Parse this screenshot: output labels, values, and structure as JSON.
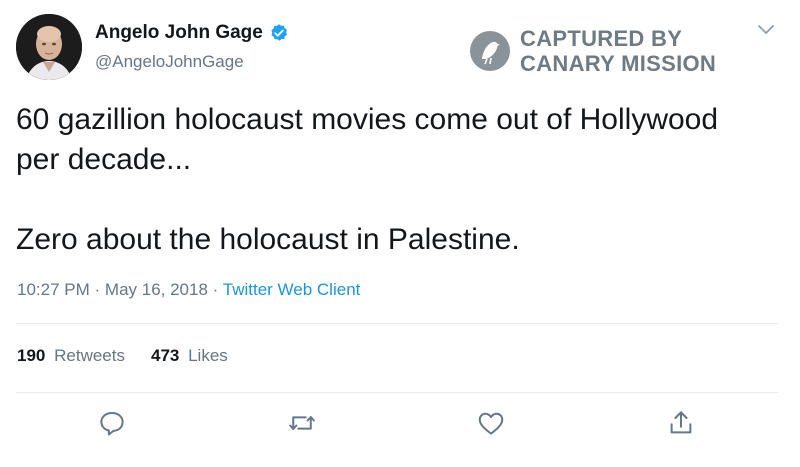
{
  "user": {
    "display_name": "Angelo John Gage",
    "handle": "@AngeloJohnGage",
    "verified": true
  },
  "watermark": {
    "line1": "CAPTURED BY",
    "line2": "CANARY MISSION"
  },
  "tweet": {
    "lines": [
      "60 gazillion holocaust movies come out of Hollywood",
      "per decade...",
      "Zero about the holocaust in Palestine."
    ]
  },
  "meta": {
    "time": "10:27 PM",
    "sep1": "·",
    "date": "May 16, 2018",
    "sep2": "·",
    "source": "Twitter Web Client"
  },
  "stats": {
    "retweets_count": "190",
    "retweets_label": "Retweets",
    "likes_count": "473",
    "likes_label": "Likes"
  },
  "colors": {
    "text": "#14171a",
    "muted": "#657786",
    "link": "#1b95e0",
    "divider": "#e6ecf0",
    "verified": "#1da1f2"
  },
  "icons": {
    "reply": "reply-icon",
    "retweet": "retweet-icon",
    "like": "like-icon",
    "share": "share-icon",
    "more": "chevron-down-icon"
  }
}
